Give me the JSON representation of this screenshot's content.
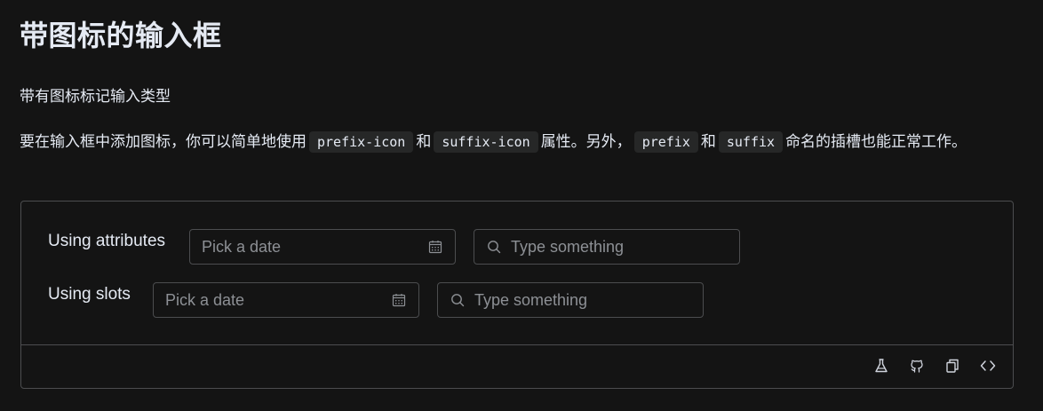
{
  "page": {
    "title": "带图标的输入框",
    "subtitle": "带有图标标记输入类型",
    "description": {
      "part1": "要在输入框中添加图标，你可以简单地使用",
      "code1": "prefix-icon",
      "part2": "和",
      "code2": "suffix-icon",
      "part3": "属性。另外，",
      "code3": "prefix",
      "part4": "和",
      "code4": "suffix",
      "part5": "命名的插槽也能正常工作。"
    }
  },
  "demo": {
    "rows": [
      {
        "label": "Using attributes",
        "date_placeholder": "Pick a date",
        "search_placeholder": "Type something"
      },
      {
        "label": "Using slots",
        "date_placeholder": "Pick a date",
        "search_placeholder": "Type something"
      }
    ],
    "toolbar": {
      "icons": [
        "playground-icon",
        "github-icon",
        "copy-icon",
        "code-icon"
      ]
    }
  },
  "colors": {
    "background": "#141414",
    "border": "#4c4d4f",
    "text": "#e5eaf3",
    "placeholder": "#8d9095",
    "code_bg": "#262727"
  }
}
